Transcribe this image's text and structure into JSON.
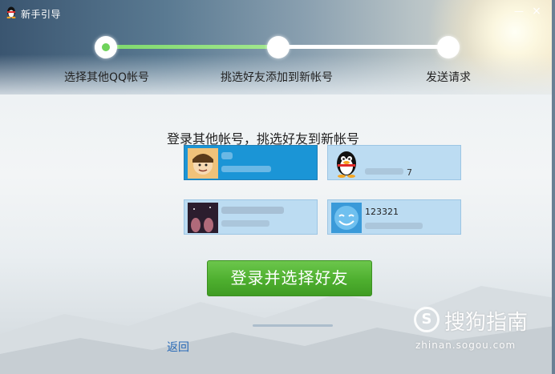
{
  "window": {
    "title": "新手引导",
    "minimize_symbol": "—",
    "close_symbol": "×"
  },
  "progress": {
    "steps": [
      {
        "label": "选择其他QQ帐号"
      },
      {
        "label": "挑选好友添加到新帐号"
      },
      {
        "label": "发送请求"
      }
    ],
    "current_step": 1,
    "fill_fraction": 0.5,
    "colors": {
      "active": "#6fd35b",
      "track": "#ffffff"
    }
  },
  "main": {
    "headline": "登录其他帐号，挑选好友到新帐号",
    "accounts": [
      {
        "avatar": "cartoon-boy-avatar",
        "selected": true,
        "number_visible": ""
      },
      {
        "avatar": "qq-penguin-avatar",
        "selected": false,
        "number_visible": "7"
      },
      {
        "avatar": "night-sky-avatar",
        "selected": false,
        "number_visible": ""
      },
      {
        "avatar": "blue-smile-avatar",
        "selected": false,
        "number_visible": "123321"
      }
    ],
    "login_button": "登录并选择好友",
    "back_link": "返回"
  },
  "watermark": {
    "icon": "sogou-s-logo",
    "text": "搜狗指南",
    "url": "zhinan.sogou.com"
  },
  "colors": {
    "selected_card": "#1b95d6",
    "card": "#bcdcf2",
    "button": "#4eaf2f",
    "link": "#2a6bb8"
  }
}
